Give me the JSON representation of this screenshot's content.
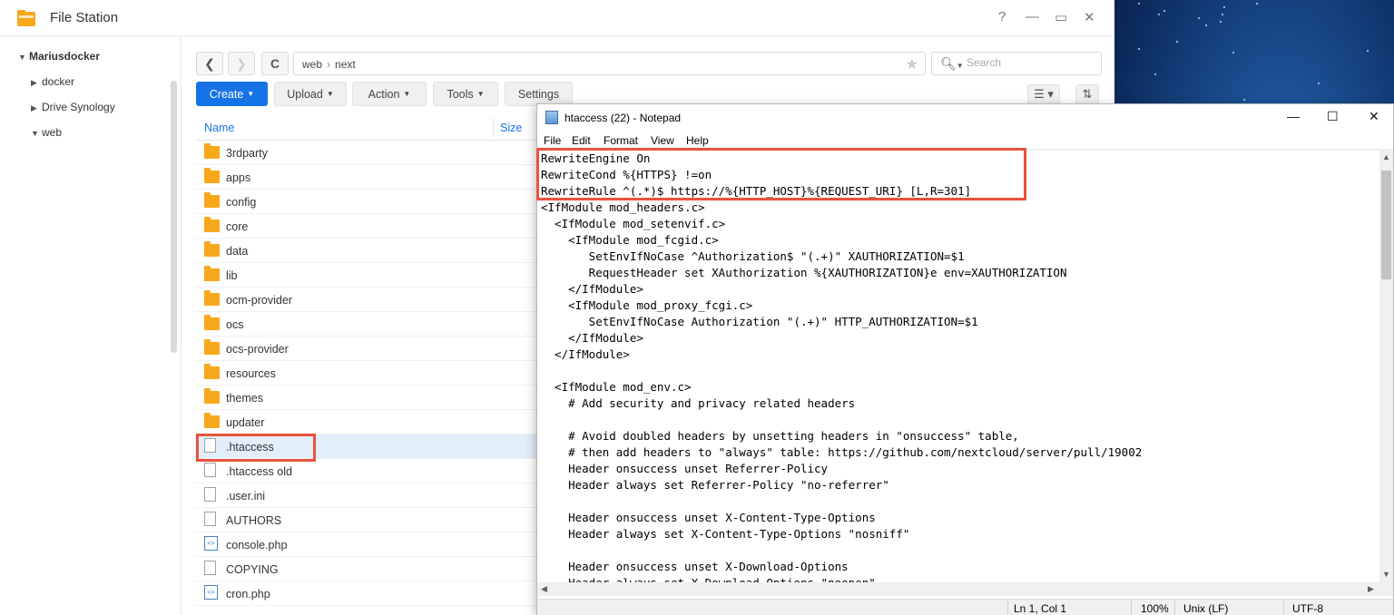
{
  "file_station": {
    "title": "File Station",
    "controls": {
      "help": "?",
      "minimize": "—",
      "maximize": "▭",
      "close": "✕"
    },
    "sidebar": {
      "root": "Mariusdocker",
      "items": [
        "docker",
        "Drive Synology",
        "web"
      ]
    },
    "nav": {
      "back": "❮",
      "forward": "❯",
      "refresh": "C"
    },
    "path": [
      "web",
      "next"
    ],
    "path_separator": "›",
    "search": {
      "placeholder": "Search"
    },
    "toolbar": {
      "create": "Create",
      "upload": "Upload",
      "action": "Action",
      "tools": "Tools",
      "settings": "Settings"
    },
    "columns": {
      "name": "Name",
      "size": "Size"
    },
    "files": [
      {
        "name": "3rdparty",
        "type": "folder"
      },
      {
        "name": "apps",
        "type": "folder"
      },
      {
        "name": "config",
        "type": "folder"
      },
      {
        "name": "core",
        "type": "folder"
      },
      {
        "name": "data",
        "type": "folder"
      },
      {
        "name": "lib",
        "type": "folder"
      },
      {
        "name": "ocm-provider",
        "type": "folder"
      },
      {
        "name": "ocs",
        "type": "folder"
      },
      {
        "name": "ocs-provider",
        "type": "folder"
      },
      {
        "name": "resources",
        "type": "folder"
      },
      {
        "name": "themes",
        "type": "folder"
      },
      {
        "name": "updater",
        "type": "folder"
      },
      {
        "name": ".htaccess",
        "type": "file",
        "selected": true
      },
      {
        "name": ".htaccess old",
        "type": "file"
      },
      {
        "name": ".user.ini",
        "type": "file"
      },
      {
        "name": "AUTHORS",
        "type": "file"
      },
      {
        "name": "console.php",
        "type": "php"
      },
      {
        "name": "COPYING",
        "type": "file"
      },
      {
        "name": "cron.php",
        "type": "php"
      }
    ],
    "accent_color": "#1673e6",
    "folder_color": "#f7a81b"
  },
  "notepad": {
    "title": "htaccess (22) - Notepad",
    "controls": {
      "minimize": "—",
      "maximize": "☐",
      "close": "✕"
    },
    "menu": [
      "File",
      "Edit",
      "Format",
      "View",
      "Help"
    ],
    "lines": [
      "RewriteEngine On",
      "RewriteCond %{HTTPS} !=on",
      "RewriteRule ^(.*)$ https://%{HTTP_HOST}%{REQUEST_URI} [L,R=301]",
      "<IfModule mod_headers.c>",
      "  <IfModule mod_setenvif.c>",
      "    <IfModule mod_fcgid.c>",
      "       SetEnvIfNoCase ^Authorization$ \"(.+)\" XAUTHORIZATION=$1",
      "       RequestHeader set XAuthorization %{XAUTHORIZATION}e env=XAUTHORIZATION",
      "    </IfModule>",
      "    <IfModule mod_proxy_fcgi.c>",
      "       SetEnvIfNoCase Authorization \"(.+)\" HTTP_AUTHORIZATION=$1",
      "    </IfModule>",
      "  </IfModule>",
      "",
      "  <IfModule mod_env.c>",
      "    # Add security and privacy related headers",
      "",
      "    # Avoid doubled headers by unsetting headers in \"onsuccess\" table,",
      "    # then add headers to \"always\" table: https://github.com/nextcloud/server/pull/19002",
      "    Header onsuccess unset Referrer-Policy",
      "    Header always set Referrer-Policy \"no-referrer\"",
      "",
      "    Header onsuccess unset X-Content-Type-Options",
      "    Header always set X-Content-Type-Options \"nosniff\"",
      "",
      "    Header onsuccess unset X-Download-Options",
      "    Header always set X-Download-Options \"noopen\""
    ],
    "status": {
      "position": "Ln 1, Col 1",
      "zoom": "100%",
      "line_ending": "Unix (LF)",
      "encoding": "UTF-8"
    }
  },
  "highlight_color": "#e8533f"
}
